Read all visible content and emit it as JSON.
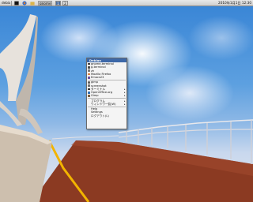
{
  "taskbar": {
    "menu_label": "debian",
    "task_label": "gnome",
    "pager": [
      "1",
      "2"
    ],
    "clock": "2010年1月1日 12:30"
  },
  "menu": {
    "title": "Debian",
    "items": [
      {
        "label": "gnome-terminal",
        "icon": "terminal-icon",
        "color": "#3b3b3b",
        "submenu": false
      },
      {
        "label": "g-terminal",
        "icon": "terminal-icon",
        "color": "#4a4a4a",
        "submenu": false
      },
      {
        "label": "zh",
        "icon": "app-icon",
        "color": "#7a7a7a",
        "submenu": false
      },
      {
        "label": "Mozilla Firefox",
        "icon": "firefox-icon",
        "color": "#d66a1e",
        "submenu": false
      },
      {
        "label": "Emacs23",
        "icon": "emacs-icon",
        "color": "#6b4fa0",
        "submenu": false
      },
      {
        "label": "gimp",
        "icon": "gimp-icon",
        "color": "#5a5a5a",
        "submenu": false
      },
      {
        "label": "screenshot",
        "icon": "camera-icon",
        "color": "#6d6d6d",
        "submenu": false
      },
      {
        "label": "ターミナル",
        "icon": "terminal-icon",
        "color": "#2e2e2e",
        "submenu": true
      },
      {
        "label": "OpenOffice.org",
        "icon": "office-icon",
        "color": "#2f6fb5",
        "submenu": true
      },
      {
        "label": "Gimp",
        "icon": "gimp-icon",
        "color": "#7b5d3a",
        "submenu": true
      },
      {
        "label": "プログラム",
        "icon": null,
        "submenu": true
      },
      {
        "label": "ウィンドウ一覧(W)",
        "icon": null,
        "submenu": true
      },
      {
        "label": "Help",
        "icon": null,
        "submenu": false
      },
      {
        "label": "Settings",
        "icon": null,
        "submenu": false
      },
      {
        "label": "ログアウト(L)",
        "icon": null,
        "submenu": false
      }
    ]
  },
  "colors": {
    "menu_title_bg": "#3d68a8",
    "road": "#8b3a22",
    "road_line": "#f2b400"
  }
}
